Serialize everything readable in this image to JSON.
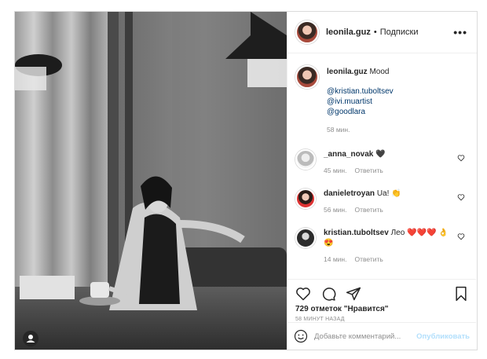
{
  "post": {
    "username": "leonila.guz",
    "separator": "•",
    "follow_label": "Подписки",
    "more_label": "•••",
    "caption": {
      "username": "leonila.guz",
      "text": "Mood",
      "mentions": [
        "@kristian.tuboltsev",
        "@ivi.muartist",
        "@goodlara"
      ],
      "time": "58 мин."
    },
    "comments": [
      {
        "username": "_anna_novak",
        "text": "🖤",
        "time": "45 мин.",
        "reply": "Ответить"
      },
      {
        "username": "danieletroyan",
        "text": "Ua! 👏",
        "time": "56 мин.",
        "reply": "Ответить"
      },
      {
        "username": "kristian.tuboltsev",
        "text": "Лео ❤️❤️❤️ 👌😍",
        "time": "14 мин.",
        "reply": "Ответить"
      }
    ],
    "likes_text": "729 отметок \"Нравится\"",
    "posted_ago": "58 минут назад",
    "add_comment_placeholder": "Добавьте комментарий...",
    "publish_label": "Опубликовать"
  },
  "colors": {
    "border": "#dbdbdb",
    "muted": "#8e8e8e",
    "mention": "#00376b",
    "publish_disabled": "#b2dffc"
  }
}
